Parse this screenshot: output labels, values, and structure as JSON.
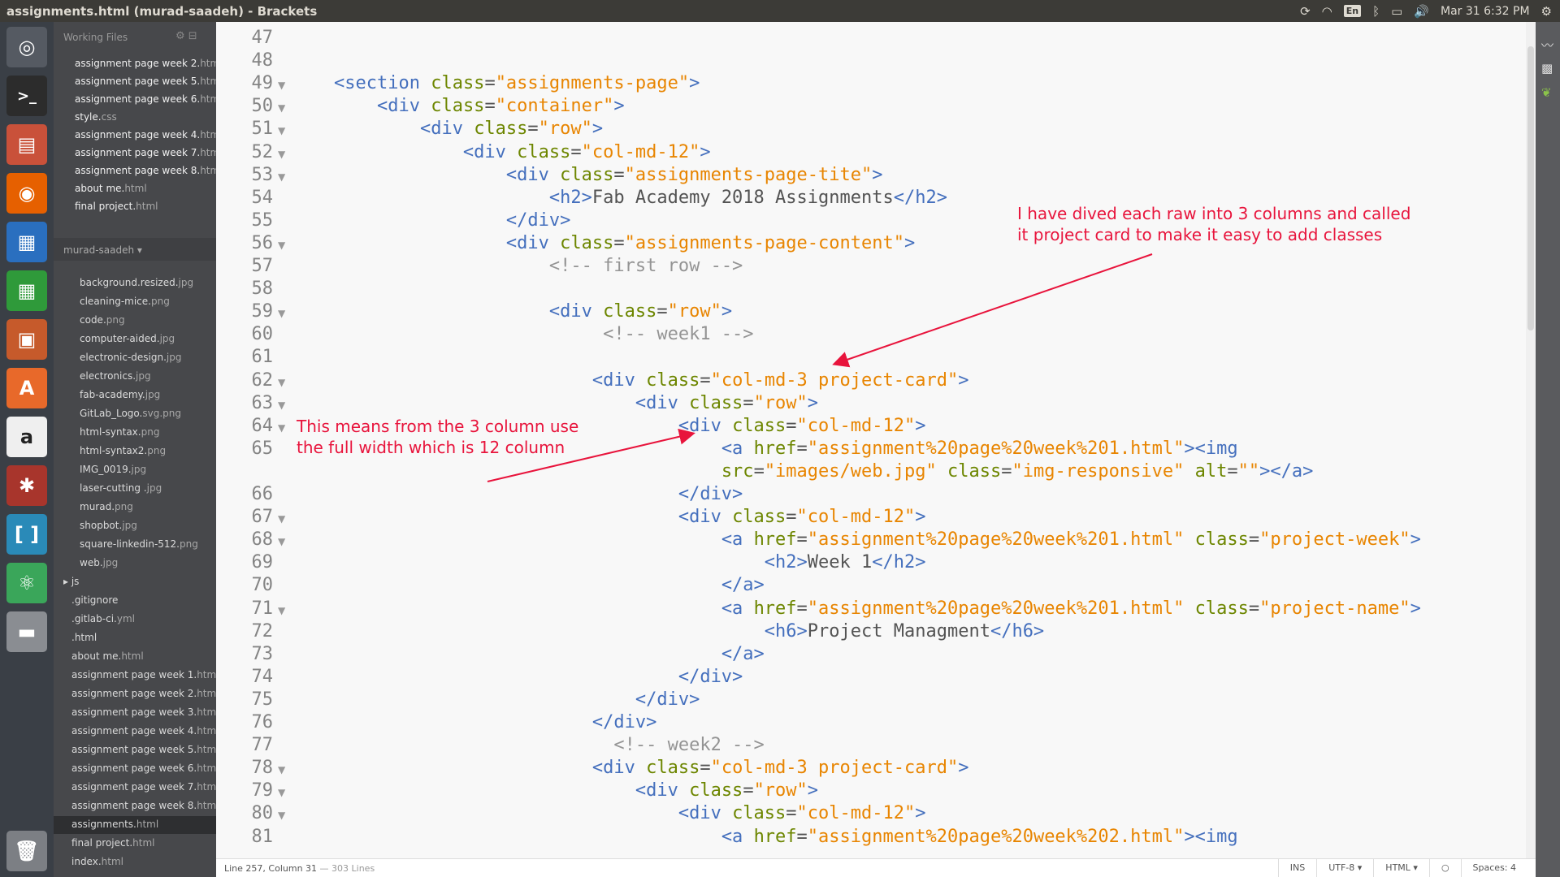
{
  "window": {
    "title": "assignments.html (murad-saadeh) - Brackets"
  },
  "tray": {
    "keyboard": "En",
    "clock": "Mar 31  6:32 PM"
  },
  "sidebar": {
    "working_files_label": "Working Files",
    "working_files": [
      {
        "name": "assignment page week 2.",
        "ext": "html"
      },
      {
        "name": "assignment page week 5.",
        "ext": "html"
      },
      {
        "name": "assignment page week 6.",
        "ext": "html"
      },
      {
        "name": "style.",
        "ext": "css"
      },
      {
        "name": "assignment page week 4.",
        "ext": "html"
      },
      {
        "name": "assignment page week 7.",
        "ext": "html"
      },
      {
        "name": "assignment page week 8.",
        "ext": "html"
      },
      {
        "name": "about me.",
        "ext": "html"
      },
      {
        "name": "final project.",
        "ext": "html"
      }
    ],
    "project_name": "murad-saadeh ▾",
    "image_files": [
      {
        "name": "background.resized.",
        "ext": "jpg"
      },
      {
        "name": "cleaning-mice.",
        "ext": "png"
      },
      {
        "name": "code.",
        "ext": "png"
      },
      {
        "name": "computer-aided.",
        "ext": "jpg"
      },
      {
        "name": "electronic-design.",
        "ext": "jpg"
      },
      {
        "name": "electronics.",
        "ext": "jpg"
      },
      {
        "name": "fab-academy.",
        "ext": "jpg"
      },
      {
        "name": "GitLab_Logo.",
        "ext": "svg.png"
      },
      {
        "name": "html-syntax.",
        "ext": "png"
      },
      {
        "name": "html-syntax2.",
        "ext": "png"
      },
      {
        "name": "IMG_0019.",
        "ext": "jpg"
      },
      {
        "name": "laser-cutting .",
        "ext": "jpg"
      },
      {
        "name": "murad.",
        "ext": "png"
      },
      {
        "name": "shopbot.",
        "ext": "jpg"
      },
      {
        "name": "square-linkedin-512.",
        "ext": "png"
      },
      {
        "name": "web.",
        "ext": "jpg"
      }
    ],
    "js_folder": "▸ js",
    "root_files": [
      {
        "name": ".gitignore",
        "ext": ""
      },
      {
        "name": ".gitlab-ci.",
        "ext": "yml"
      },
      {
        "name": ".html",
        "ext": ""
      },
      {
        "name": "about me.",
        "ext": "html"
      },
      {
        "name": "assignment page week 1.",
        "ext": "html"
      },
      {
        "name": "assignment page week 2.",
        "ext": "html"
      },
      {
        "name": "assignment page week 3.",
        "ext": "html"
      },
      {
        "name": "assignment page week 4.",
        "ext": "html"
      },
      {
        "name": "assignment page week 5.",
        "ext": "html"
      },
      {
        "name": "assignment page week 6.",
        "ext": "html"
      },
      {
        "name": "assignment page week 7.",
        "ext": "html"
      },
      {
        "name": "assignment page week 8.",
        "ext": "html"
      },
      {
        "name": "assignments.",
        "ext": "html"
      },
      {
        "name": "final project.",
        "ext": "html"
      },
      {
        "name": "index.",
        "ext": "html"
      }
    ],
    "active_file": "assignments.html"
  },
  "editor": {
    "lines": [
      {
        "n": "47",
        "fold": false,
        "segs": []
      },
      {
        "n": "48",
        "fold": false,
        "segs": []
      },
      {
        "n": "49",
        "fold": true,
        "segs": [
          [
            "x",
            "    "
          ],
          [
            "t",
            "<section"
          ],
          [
            "x",
            " "
          ],
          [
            "a",
            "class"
          ],
          [
            "x",
            "="
          ],
          [
            "s",
            "\"assignments-page\""
          ],
          [
            "t",
            ">"
          ]
        ]
      },
      {
        "n": "50",
        "fold": true,
        "segs": [
          [
            "x",
            "        "
          ],
          [
            "t",
            "<div"
          ],
          [
            "x",
            " "
          ],
          [
            "a",
            "class"
          ],
          [
            "x",
            "="
          ],
          [
            "s",
            "\"container\""
          ],
          [
            "t",
            ">"
          ]
        ]
      },
      {
        "n": "51",
        "fold": true,
        "segs": [
          [
            "x",
            "            "
          ],
          [
            "t",
            "<div"
          ],
          [
            "x",
            " "
          ],
          [
            "a",
            "class"
          ],
          [
            "x",
            "="
          ],
          [
            "s",
            "\"row\""
          ],
          [
            "t",
            ">"
          ]
        ]
      },
      {
        "n": "52",
        "fold": true,
        "segs": [
          [
            "x",
            "                "
          ],
          [
            "t",
            "<div"
          ],
          [
            "x",
            " "
          ],
          [
            "a",
            "class"
          ],
          [
            "x",
            "="
          ],
          [
            "s",
            "\"col-md-12\""
          ],
          [
            "t",
            ">"
          ]
        ]
      },
      {
        "n": "53",
        "fold": true,
        "segs": [
          [
            "x",
            "                    "
          ],
          [
            "t",
            "<div"
          ],
          [
            "x",
            " "
          ],
          [
            "a",
            "class"
          ],
          [
            "x",
            "="
          ],
          [
            "s",
            "\"assignments-page-tite\""
          ],
          [
            "t",
            ">"
          ]
        ]
      },
      {
        "n": "54",
        "fold": false,
        "segs": [
          [
            "x",
            "                        "
          ],
          [
            "t",
            "<h2>"
          ],
          [
            "x",
            "Fab Academy 2018 Assignments"
          ],
          [
            "t",
            "</h2>"
          ]
        ]
      },
      {
        "n": "55",
        "fold": false,
        "segs": [
          [
            "x",
            "                    "
          ],
          [
            "t",
            "</div>"
          ]
        ]
      },
      {
        "n": "56",
        "fold": true,
        "segs": [
          [
            "x",
            "                    "
          ],
          [
            "t",
            "<div"
          ],
          [
            "x",
            " "
          ],
          [
            "a",
            "class"
          ],
          [
            "x",
            "="
          ],
          [
            "s",
            "\"assignments-page-content\""
          ],
          [
            "t",
            ">"
          ]
        ]
      },
      {
        "n": "57",
        "fold": false,
        "segs": [
          [
            "x",
            "                        "
          ],
          [
            "c",
            "<!-- first row -->"
          ]
        ]
      },
      {
        "n": "58",
        "fold": false,
        "segs": []
      },
      {
        "n": "59",
        "fold": true,
        "segs": [
          [
            "x",
            "                        "
          ],
          [
            "t",
            "<div"
          ],
          [
            "x",
            " "
          ],
          [
            "a",
            "class"
          ],
          [
            "x",
            "="
          ],
          [
            "s",
            "\"row\""
          ],
          [
            "t",
            ">"
          ]
        ]
      },
      {
        "n": "60",
        "fold": false,
        "segs": [
          [
            "x",
            "                             "
          ],
          [
            "c",
            "<!-- week1 -->"
          ]
        ]
      },
      {
        "n": "61",
        "fold": false,
        "segs": []
      },
      {
        "n": "62",
        "fold": true,
        "segs": [
          [
            "x",
            "                            "
          ],
          [
            "t",
            "<div"
          ],
          [
            "x",
            " "
          ],
          [
            "a",
            "class"
          ],
          [
            "x",
            "="
          ],
          [
            "s",
            "\"col-md-3 project-card\""
          ],
          [
            "t",
            ">"
          ]
        ]
      },
      {
        "n": "63",
        "fold": true,
        "segs": [
          [
            "x",
            "                                "
          ],
          [
            "t",
            "<div"
          ],
          [
            "x",
            " "
          ],
          [
            "a",
            "class"
          ],
          [
            "x",
            "="
          ],
          [
            "s",
            "\"row\""
          ],
          [
            "t",
            ">"
          ]
        ]
      },
      {
        "n": "64",
        "fold": true,
        "segs": [
          [
            "x",
            "                                    "
          ],
          [
            "t",
            "<div"
          ],
          [
            "x",
            " "
          ],
          [
            "a",
            "class"
          ],
          [
            "x",
            "="
          ],
          [
            "s",
            "\"col-md-12\""
          ],
          [
            "t",
            ">"
          ]
        ]
      },
      {
        "n": "65",
        "fold": false,
        "segs": [
          [
            "x",
            "                                        "
          ],
          [
            "t",
            "<a"
          ],
          [
            "x",
            " "
          ],
          [
            "a",
            "href"
          ],
          [
            "x",
            "="
          ],
          [
            "s",
            "\"assignment%20page%20week%201.html\""
          ],
          [
            "t",
            "><img"
          ]
        ]
      },
      {
        "n": "",
        "fold": false,
        "segs": [
          [
            "x",
            "                                        "
          ],
          [
            "a",
            "src"
          ],
          [
            "x",
            "="
          ],
          [
            "s",
            "\"images/web.jpg\""
          ],
          [
            "x",
            " "
          ],
          [
            "a",
            "class"
          ],
          [
            "x",
            "="
          ],
          [
            "s",
            "\"img-responsive\""
          ],
          [
            "x",
            " "
          ],
          [
            "a",
            "alt"
          ],
          [
            "x",
            "="
          ],
          [
            "s",
            "\"\""
          ],
          [
            "t",
            "></a>"
          ]
        ]
      },
      {
        "n": "66",
        "fold": false,
        "segs": [
          [
            "x",
            "                                    "
          ],
          [
            "t",
            "</div>"
          ]
        ]
      },
      {
        "n": "67",
        "fold": true,
        "segs": [
          [
            "x",
            "                                    "
          ],
          [
            "t",
            "<div"
          ],
          [
            "x",
            " "
          ],
          [
            "a",
            "class"
          ],
          [
            "x",
            "="
          ],
          [
            "s",
            "\"col-md-12\""
          ],
          [
            "t",
            ">"
          ]
        ]
      },
      {
        "n": "68",
        "fold": true,
        "segs": [
          [
            "x",
            "                                        "
          ],
          [
            "t",
            "<a"
          ],
          [
            "x",
            " "
          ],
          [
            "a",
            "href"
          ],
          [
            "x",
            "="
          ],
          [
            "s",
            "\"assignment%20page%20week%201.html\""
          ],
          [
            "x",
            " "
          ],
          [
            "a",
            "class"
          ],
          [
            "x",
            "="
          ],
          [
            "s",
            "\"project-week\""
          ],
          [
            "t",
            ">"
          ]
        ]
      },
      {
        "n": "69",
        "fold": false,
        "segs": [
          [
            "x",
            "                                            "
          ],
          [
            "t",
            "<h2>"
          ],
          [
            "x",
            "Week 1"
          ],
          [
            "t",
            "</h2>"
          ]
        ]
      },
      {
        "n": "70",
        "fold": false,
        "segs": [
          [
            "x",
            "                                        "
          ],
          [
            "t",
            "</a>"
          ]
        ]
      },
      {
        "n": "71",
        "fold": true,
        "segs": [
          [
            "x",
            "                                        "
          ],
          [
            "t",
            "<a"
          ],
          [
            "x",
            " "
          ],
          [
            "a",
            "href"
          ],
          [
            "x",
            "="
          ],
          [
            "s",
            "\"assignment%20page%20week%201.html\""
          ],
          [
            "x",
            " "
          ],
          [
            "a",
            "class"
          ],
          [
            "x",
            "="
          ],
          [
            "s",
            "\"project-name\""
          ],
          [
            "t",
            ">"
          ]
        ]
      },
      {
        "n": "72",
        "fold": false,
        "segs": [
          [
            "x",
            "                                            "
          ],
          [
            "t",
            "<h6>"
          ],
          [
            "x",
            "Project Managment"
          ],
          [
            "t",
            "</h6>"
          ]
        ]
      },
      {
        "n": "73",
        "fold": false,
        "segs": [
          [
            "x",
            "                                        "
          ],
          [
            "t",
            "</a>"
          ]
        ]
      },
      {
        "n": "74",
        "fold": false,
        "segs": [
          [
            "x",
            "                                    "
          ],
          [
            "t",
            "</div>"
          ]
        ]
      },
      {
        "n": "75",
        "fold": false,
        "segs": [
          [
            "x",
            "                                "
          ],
          [
            "t",
            "</div>"
          ]
        ]
      },
      {
        "n": "76",
        "fold": false,
        "segs": [
          [
            "x",
            "                            "
          ],
          [
            "t",
            "</div>"
          ]
        ]
      },
      {
        "n": "77",
        "fold": false,
        "segs": [
          [
            "x",
            "                              "
          ],
          [
            "c",
            "<!-- week2 -->"
          ]
        ]
      },
      {
        "n": "78",
        "fold": true,
        "segs": [
          [
            "x",
            "                            "
          ],
          [
            "t",
            "<div"
          ],
          [
            "x",
            " "
          ],
          [
            "a",
            "class"
          ],
          [
            "x",
            "="
          ],
          [
            "s",
            "\"col-md-3 project-card\""
          ],
          [
            "t",
            ">"
          ]
        ]
      },
      {
        "n": "79",
        "fold": true,
        "segs": [
          [
            "x",
            "                                "
          ],
          [
            "t",
            "<div"
          ],
          [
            "x",
            " "
          ],
          [
            "a",
            "class"
          ],
          [
            "x",
            "="
          ],
          [
            "s",
            "\"row\""
          ],
          [
            "t",
            ">"
          ]
        ]
      },
      {
        "n": "80",
        "fold": true,
        "segs": [
          [
            "x",
            "                                    "
          ],
          [
            "t",
            "<div"
          ],
          [
            "x",
            " "
          ],
          [
            "a",
            "class"
          ],
          [
            "x",
            "="
          ],
          [
            "s",
            "\"col-md-12\""
          ],
          [
            "t",
            ">"
          ]
        ]
      },
      {
        "n": "81",
        "fold": false,
        "segs": [
          [
            "x",
            "                                        "
          ],
          [
            "t",
            "<a"
          ],
          [
            "x",
            " "
          ],
          [
            "a",
            "href"
          ],
          [
            "x",
            "="
          ],
          [
            "s",
            "\"assignment%20page%20week%202.html\""
          ],
          [
            "t",
            "><img"
          ]
        ]
      }
    ]
  },
  "annotations": {
    "project_card_note": [
      "I have dived each raw into 3 columns and called",
      "it project card to make it easy to add classes"
    ],
    "full_width_note": [
      "This means from the 3 column use",
      "the full width which is 12 column"
    ],
    "color": "#e8143c"
  },
  "statusbar": {
    "position": "Line 257, Column 31",
    "lines": " — 303 Lines",
    "ins": "INS",
    "encoding": "UTF-8 ▾",
    "language": "HTML ▾",
    "spaces": "Spaces: 4"
  }
}
